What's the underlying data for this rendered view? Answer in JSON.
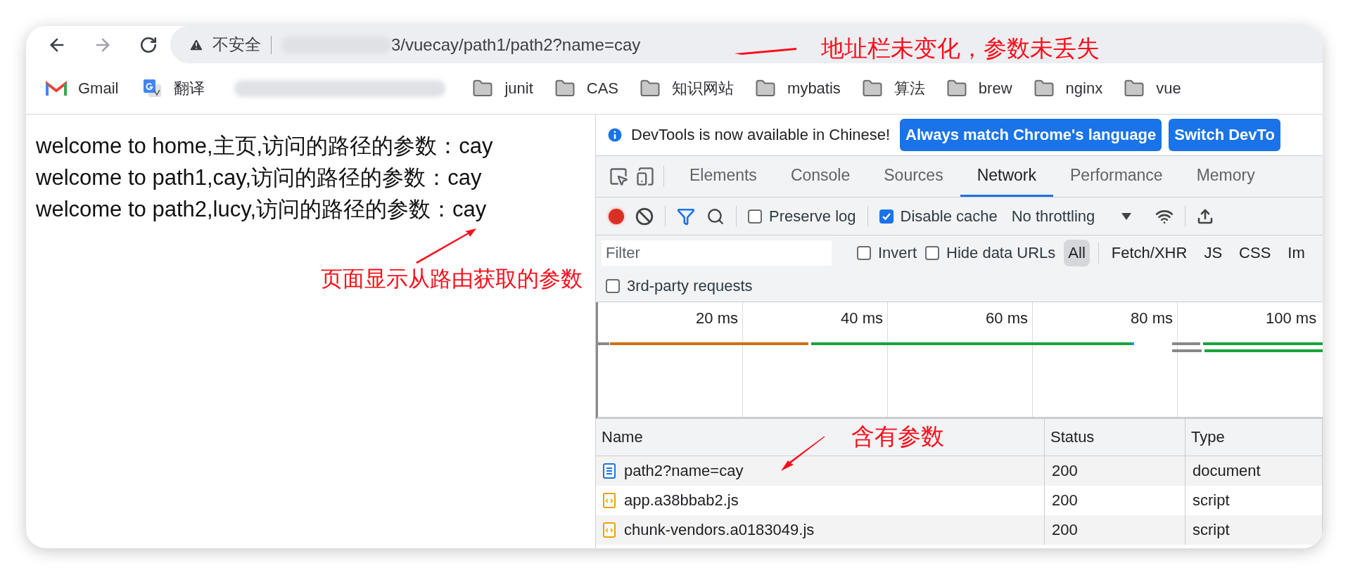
{
  "toolbar": {
    "security": "不安全",
    "url": "3/vuecay/path1/path2?name=cay"
  },
  "bookmarks": [
    {
      "kind": "gmail",
      "label": "Gmail"
    },
    {
      "kind": "translate",
      "label": "翻译"
    },
    {
      "kind": "blurred"
    },
    {
      "kind": "folder",
      "label": "junit"
    },
    {
      "kind": "folder",
      "label": "CAS"
    },
    {
      "kind": "folder",
      "label": "知识网站"
    },
    {
      "kind": "folder",
      "label": "mybatis"
    },
    {
      "kind": "folder",
      "label": "算法"
    },
    {
      "kind": "folder",
      "label": "brew"
    },
    {
      "kind": "folder",
      "label": "nginx"
    },
    {
      "kind": "folder",
      "label": "vue"
    }
  ],
  "page": {
    "lines": [
      "welcome to home,主页,访问的路径的参数：cay",
      "welcome to path1,cay,访问的路径的参数：cay",
      "welcome to path2,lucy,访问的路径的参数：cay"
    ]
  },
  "devtools": {
    "infobar": {
      "message": "DevTools is now available in Chinese!",
      "buttons": [
        "Always match Chrome's language",
        "Switch DevTo"
      ]
    },
    "tabs": [
      {
        "label": "Elements",
        "selected": false
      },
      {
        "label": "Console",
        "selected": false
      },
      {
        "label": "Sources",
        "selected": false
      },
      {
        "label": "Network",
        "selected": true
      },
      {
        "label": "Performance",
        "selected": false
      },
      {
        "label": "Memory",
        "selected": false
      }
    ],
    "network_toolbar": {
      "recording": true,
      "preserve_log": {
        "label": "Preserve log",
        "checked": false
      },
      "disable_cache": {
        "label": "Disable cache",
        "checked": true
      },
      "throttling": "No throttling"
    },
    "filter": {
      "placeholder": "Filter",
      "invert": {
        "label": "Invert",
        "checked": false
      },
      "hide_data_urls": {
        "label": "Hide data URLs",
        "checked": false
      },
      "types": [
        {
          "label": "All",
          "selected": true
        },
        {
          "label": "Fetch/XHR",
          "selected": false
        },
        {
          "label": "JS",
          "selected": false
        },
        {
          "label": "CSS",
          "selected": false
        },
        {
          "label": "Im",
          "selected": false
        }
      ]
    },
    "third_party": {
      "label": "3rd-party requests",
      "checked": false
    },
    "timeline": {
      "ticks": [
        "20 ms",
        "40 ms",
        "60 ms",
        "80 ms",
        "100 ms"
      ]
    },
    "table": {
      "columns": [
        "Name",
        "Status",
        "Type"
      ],
      "rows": [
        {
          "kind": "document",
          "name": "path2?name=cay",
          "status": "200",
          "type": "document"
        },
        {
          "kind": "script",
          "name": "app.a38bbab2.js",
          "status": "200",
          "type": "script"
        },
        {
          "kind": "script",
          "name": "chunk-vendors.a0183049.js",
          "status": "200",
          "type": "script"
        }
      ]
    }
  },
  "annotations": [
    "地址栏未变化，参数未丢失",
    "页面显示从路由获取的参数",
    "含有参数"
  ]
}
